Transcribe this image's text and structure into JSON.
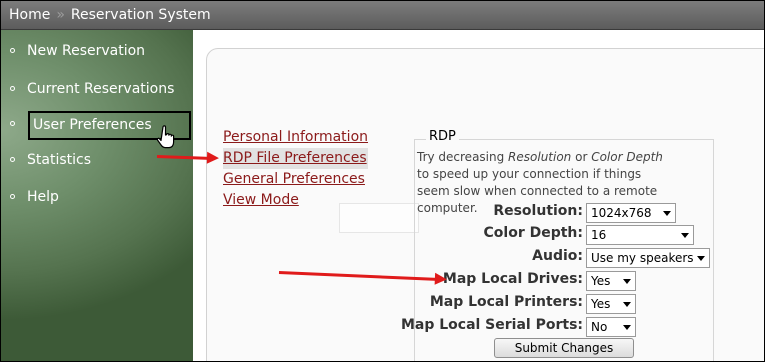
{
  "breadcrumb": {
    "home": "Home",
    "separator": "»",
    "current": "Reservation System"
  },
  "sidebar": {
    "items": [
      {
        "label": "New Reservation"
      },
      {
        "label": "Current Reservations"
      },
      {
        "label": "User Preferences",
        "active": true
      },
      {
        "label": "Statistics"
      },
      {
        "label": "Help"
      }
    ]
  },
  "links": [
    {
      "label": "Personal Information"
    },
    {
      "label": "RDP File Preferences"
    },
    {
      "label": "General Preferences"
    },
    {
      "label": "View Mode"
    }
  ],
  "rdp": {
    "legend": "RDP",
    "hint_prefix": "Try decreasing ",
    "hint_res": "Resolution",
    "hint_or": " or ",
    "hint_depth": "Color Depth",
    "hint_suffix": " to speed up your connection if things seem slow when connected to a remote computer.",
    "fields": {
      "resolution": {
        "label": "Resolution:",
        "value": "1024x768"
      },
      "color_depth": {
        "label": "Color Depth:",
        "value": "16"
      },
      "audio": {
        "label": "Audio:",
        "value": "Use my speakers"
      },
      "map_drives": {
        "label": "Map Local Drives:",
        "value": "Yes"
      },
      "map_printers": {
        "label": "Map Local Printers:",
        "value": "Yes"
      },
      "map_serial": {
        "label": "Map Local Serial Ports:",
        "value": "No"
      }
    },
    "submit_label": "Submit Changes"
  },
  "colors": {
    "link": "#8b1a1a",
    "annotation_arrow": "#e01b1b",
    "sidebar": "#6f8f6b"
  }
}
